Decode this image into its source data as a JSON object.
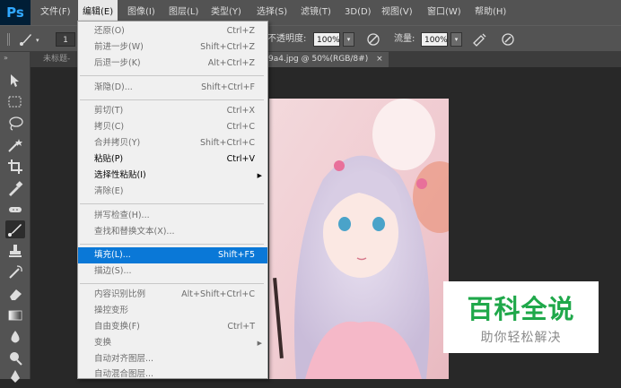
{
  "app": {
    "logo": "Ps"
  },
  "menubar": {
    "items": [
      {
        "label": "文件(F)"
      },
      {
        "label": "编辑(E)"
      },
      {
        "label": "图像(I)"
      },
      {
        "label": "图层(L)"
      },
      {
        "label": "类型(Y)"
      },
      {
        "label": "选择(S)"
      },
      {
        "label": "滤镜(T)"
      },
      {
        "label": "3D(D)"
      },
      {
        "label": "视图(V)"
      },
      {
        "label": "窗口(W)"
      },
      {
        "label": "帮助(H)"
      }
    ],
    "active_index": 1
  },
  "options_bar": {
    "brush_size": "1",
    "opacity_label": "不透明度:",
    "opacity_value": "100%",
    "flow_label": "流量:",
    "flow_value": "100%"
  },
  "tabs": [
    {
      "label": "未标题-"
    },
    {
      "label": "9a4.jpg @ 50%(RGB/8#)",
      "close": "×"
    }
  ],
  "edit_menu": {
    "items": [
      {
        "label": "还原(O)",
        "shortcut": "Ctrl+Z",
        "state": "disabled"
      },
      {
        "label": "前进一步(W)",
        "shortcut": "Shift+Ctrl+Z",
        "state": "disabled"
      },
      {
        "label": "后退一步(K)",
        "shortcut": "Alt+Ctrl+Z",
        "state": "disabled"
      },
      {
        "label": "渐隐(D)...",
        "shortcut": "Shift+Ctrl+F",
        "state": "disabled"
      },
      {
        "label": "剪切(T)",
        "shortcut": "Ctrl+X",
        "state": "disabled"
      },
      {
        "label": "拷贝(C)",
        "shortcut": "Ctrl+C",
        "state": "disabled"
      },
      {
        "label": "合并拷贝(Y)",
        "shortcut": "Shift+Ctrl+C",
        "state": "disabled"
      },
      {
        "label": "粘贴(P)",
        "shortcut": "Ctrl+V",
        "state": "enabled"
      },
      {
        "label": "选择性粘贴(I)",
        "shortcut": "",
        "state": "enabled",
        "submenu": true
      },
      {
        "label": "清除(E)",
        "shortcut": "",
        "state": "disabled"
      },
      {
        "label": "拼写检查(H)...",
        "shortcut": "",
        "state": "disabled"
      },
      {
        "label": "查找和替换文本(X)...",
        "shortcut": "",
        "state": "disabled"
      },
      {
        "label": "填充(L)...",
        "shortcut": "Shift+F5",
        "state": "highlight"
      },
      {
        "label": "描边(S)...",
        "shortcut": "",
        "state": "disabled"
      },
      {
        "label": "内容识别比例",
        "shortcut": "Alt+Shift+Ctrl+C",
        "state": "disabled"
      },
      {
        "label": "操控变形",
        "shortcut": "",
        "state": "disabled"
      },
      {
        "label": "自由变换(F)",
        "shortcut": "Ctrl+T",
        "state": "disabled"
      },
      {
        "label": "变换",
        "shortcut": "",
        "state": "disabled",
        "submenu": true
      },
      {
        "label": "自动对齐图层...",
        "shortcut": "",
        "state": "disabled"
      },
      {
        "label": "自动混合图层...",
        "shortcut": "",
        "state": "disabled"
      }
    ]
  },
  "watermark": {
    "title": "百科全说",
    "subtitle": "助你轻松解决"
  },
  "colors": {
    "accent": "#0a78d7",
    "watermark_green": "#1fa84a",
    "ui_gray": "#535353"
  }
}
